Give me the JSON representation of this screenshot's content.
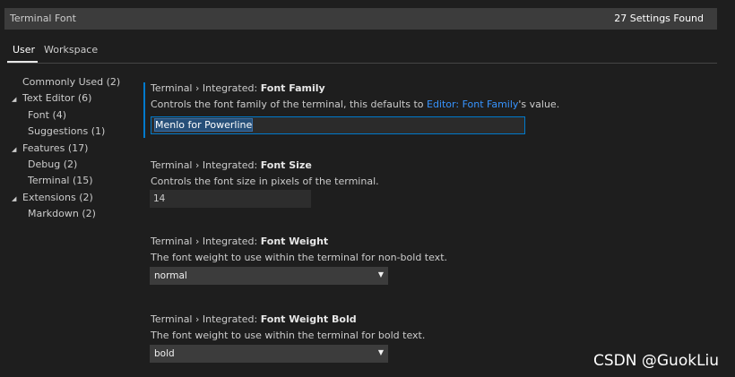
{
  "search": {
    "value": "Terminal Font",
    "result_count": "27 Settings Found"
  },
  "tabs": [
    {
      "label": "User"
    },
    {
      "label": "Workspace"
    }
  ],
  "toc": [
    {
      "label": "Commonly Used",
      "count": "(2)"
    },
    {
      "label": "Text Editor",
      "count": "(6)"
    },
    {
      "label": "Font",
      "count": "(4)"
    },
    {
      "label": "Suggestions",
      "count": "(1)"
    },
    {
      "label": "Features",
      "count": "(17)"
    },
    {
      "label": "Debug",
      "count": "(2)"
    },
    {
      "label": "Terminal",
      "count": "(15)"
    },
    {
      "label": "Extensions",
      "count": "(2)"
    },
    {
      "label": "Markdown",
      "count": "(2)"
    }
  ],
  "settings": {
    "font_family": {
      "category": "Terminal › Integrated: ",
      "name": "Font Family",
      "desc_before": "Controls the font family of the terminal, this defaults to ",
      "desc_link": "Editor: Font Family",
      "desc_after": "'s value.",
      "value": "Menlo for Powerline"
    },
    "font_size": {
      "category": "Terminal › Integrated: ",
      "name": "Font Size",
      "desc": "Controls the font size in pixels of the terminal.",
      "value": "14"
    },
    "font_weight": {
      "category": "Terminal › Integrated: ",
      "name": "Font Weight",
      "desc": "The font weight to use within the terminal for non-bold text.",
      "value": "normal"
    },
    "font_weight_bold": {
      "category": "Terminal › Integrated: ",
      "name": "Font Weight Bold",
      "desc": "The font weight to use within the terminal for bold text.",
      "value": "bold"
    }
  },
  "watermark": "CSDN @GuokLiu",
  "colors": {
    "accent": "#007acc",
    "link": "#3794ff",
    "background": "#1e1e1e"
  }
}
